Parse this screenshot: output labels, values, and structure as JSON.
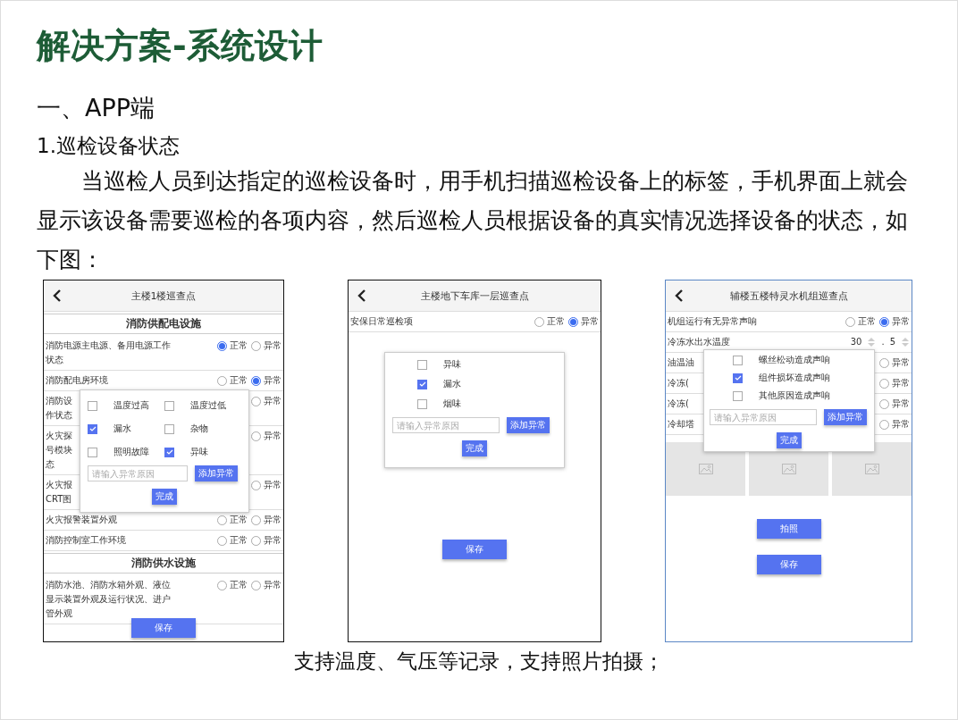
{
  "title": "解决方案-系统设计",
  "heading": "一、APP端",
  "subheading": "1.巡检设备状态",
  "paragraph": "当巡检人员到达指定的巡检设备时，用手机扫描巡检设备上的标签，手机界面上就会显示该设备需要巡检的各项内容，然后巡检人员根据设备的真实情况选择设备的状态，如下图：",
  "phones": [
    {
      "kind": "checklist",
      "title": "主楼1楼巡查点",
      "rows": [
        {
          "kind": "section",
          "lines": [
            "消防供配电设施"
          ]
        },
        {
          "kind": "radio",
          "lines": [
            "消防电源主电源、备用电源工作",
            "状态"
          ],
          "options": [
            {
              "label": "正常",
              "selected": true
            },
            {
              "label": "异常",
              "selected": false
            }
          ]
        },
        {
          "kind": "radio",
          "lines": [
            "消防配电房环境"
          ],
          "options": [
            {
              "label": "正常",
              "selected": false
            },
            {
              "label": "异常",
              "selected": true
            }
          ]
        },
        {
          "kind": "radio",
          "lines": [
            "消防设",
            "作状态"
          ],
          "options": [
            {
              "label": "异常",
              "selected": false
            }
          ]
        },
        {
          "kind": "radio",
          "lines": [
            "火灾探",
            "号模块",
            "态"
          ],
          "options": [
            {
              "label": "异常",
              "selected": false
            }
          ]
        },
        {
          "kind": "radio",
          "lines": [
            "火灾报",
            "CRT图"
          ],
          "options": [
            {
              "label": "异常",
              "selected": false
            }
          ]
        },
        {
          "kind": "radio",
          "lines": [
            "火灾报警装置外观"
          ],
          "options": [
            {
              "label": "正常",
              "selected": false
            },
            {
              "label": "异常",
              "selected": false
            }
          ]
        },
        {
          "kind": "radio",
          "lines": [
            "消防控制室工作环境"
          ],
          "options": [
            {
              "label": "正常",
              "selected": false
            },
            {
              "label": "异常",
              "selected": false
            }
          ]
        },
        {
          "kind": "section",
          "lines": [
            "消防供水设施"
          ]
        },
        {
          "kind": "radio",
          "lines": [
            "消防水池、消防水箱外观、液位",
            "显示装置外观及运行状况、进户",
            "管外观"
          ],
          "options": [
            {
              "label": "正常",
              "selected": false
            },
            {
              "label": "异常",
              "selected": false
            }
          ]
        }
      ],
      "popup": {
        "kind": "grid",
        "options": [
          {
            "label": "温度过高",
            "checked": false
          },
          {
            "label": "温度过低",
            "checked": false
          },
          {
            "label": "漏水",
            "checked": true
          },
          {
            "label": "杂物",
            "checked": false
          },
          {
            "label": "照明故障",
            "checked": false
          },
          {
            "label": "异味",
            "checked": true
          }
        ],
        "placeholder": "请输入异常原因",
        "add_button": "添加异常",
        "done_button": "完成"
      },
      "buttons": [
        "保存"
      ]
    },
    {
      "kind": "checklist",
      "title": "主楼地下车库一层巡查点",
      "rows": [
        {
          "kind": "radio",
          "lines": [
            "安保日常巡检项"
          ],
          "options": [
            {
              "label": "正常",
              "selected": false
            },
            {
              "label": "异常",
              "selected": true
            }
          ]
        }
      ],
      "popup": {
        "kind": "inline",
        "options": [
          {
            "label": "异味",
            "checked": false
          },
          {
            "label": "漏水",
            "checked": true
          },
          {
            "label": "烟味",
            "checked": false
          }
        ],
        "placeholder": "请输入异常原因",
        "add_button": "添加异常",
        "done_button": "完成"
      },
      "buttons": [
        "保存"
      ]
    },
    {
      "kind": "photo-form",
      "title": "辅楼五楼特灵水机组巡查点",
      "rows": [
        {
          "kind": "radio",
          "lines": [
            "机组运行有无异常声响"
          ],
          "options": [
            {
              "label": "正常",
              "selected": false
            },
            {
              "label": "异常",
              "selected": true
            }
          ]
        },
        {
          "kind": "stepper",
          "lines": [
            "冷冻水出水温度"
          ],
          "values": [
            "30",
            "5"
          ],
          "separator": "."
        },
        {
          "kind": "radio",
          "lines": [
            "油温油"
          ],
          "options": [
            {
              "label": "异常",
              "selected": false
            }
          ]
        },
        {
          "kind": "radio",
          "lines": [
            "冷冻("
          ],
          "options": [
            {
              "label": "异常",
              "selected": false
            }
          ]
        },
        {
          "kind": "radio",
          "lines": [
            "冷冻("
          ],
          "options": [
            {
              "label": "异常",
              "selected": false
            }
          ]
        },
        {
          "kind": "radio",
          "lines": [
            "冷却塔"
          ],
          "options": [
            {
              "label": "异常",
              "selected": false
            }
          ]
        }
      ],
      "popup": {
        "kind": "overlay",
        "options": [
          {
            "label": "螺丝松动造成声响",
            "checked": false
          },
          {
            "label": "组件损坏造成声响",
            "checked": true
          },
          {
            "label": "其他原因造成声响",
            "checked": false
          }
        ],
        "placeholder": "请输入异常原因",
        "add_button": "添加异常",
        "done_button": "完成"
      },
      "buttons": [
        "拍照",
        "保存"
      ]
    }
  ],
  "caption": "支持温度、气压等记录，支持照片拍摄；"
}
